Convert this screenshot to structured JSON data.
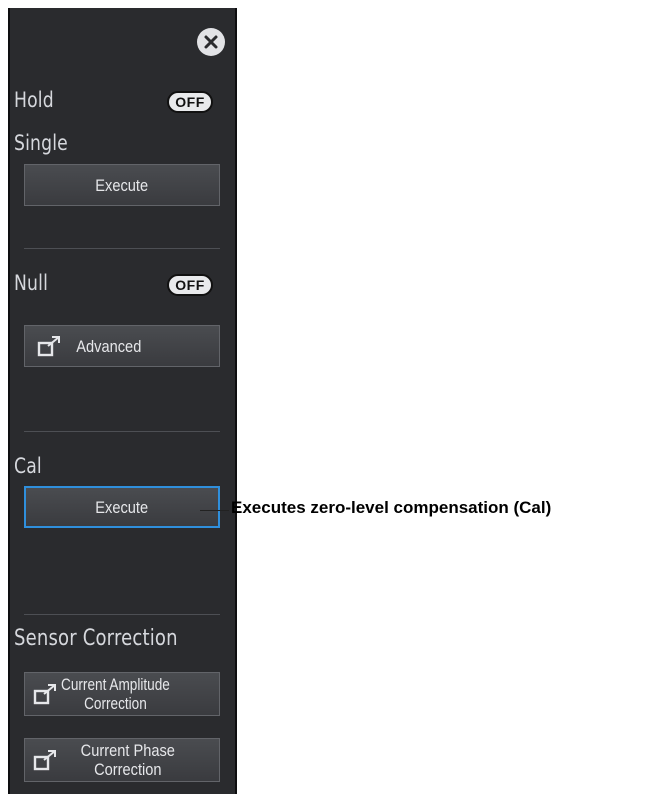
{
  "hold": {
    "label": "Hold",
    "state": "OFF"
  },
  "single": {
    "label": "Single",
    "button": "Execute"
  },
  "null": {
    "label": "Null",
    "state": "OFF",
    "advanced": "Advanced"
  },
  "cal": {
    "label": "Cal",
    "button": "Execute"
  },
  "sensor_correction": {
    "label": "Sensor Correction",
    "amplitude": [
      "Current Amplitude",
      "Correction"
    ],
    "phase": [
      "Current Phase",
      "Correction"
    ]
  },
  "callout": "Executes zero-level compensation (Cal)",
  "icons": {
    "close": "close-icon",
    "external": "external-link-icon"
  },
  "colors": {
    "panel": "#2a2b2e",
    "selected_border": "#2f8fdc",
    "toggle_bg": "#e9eaec"
  }
}
